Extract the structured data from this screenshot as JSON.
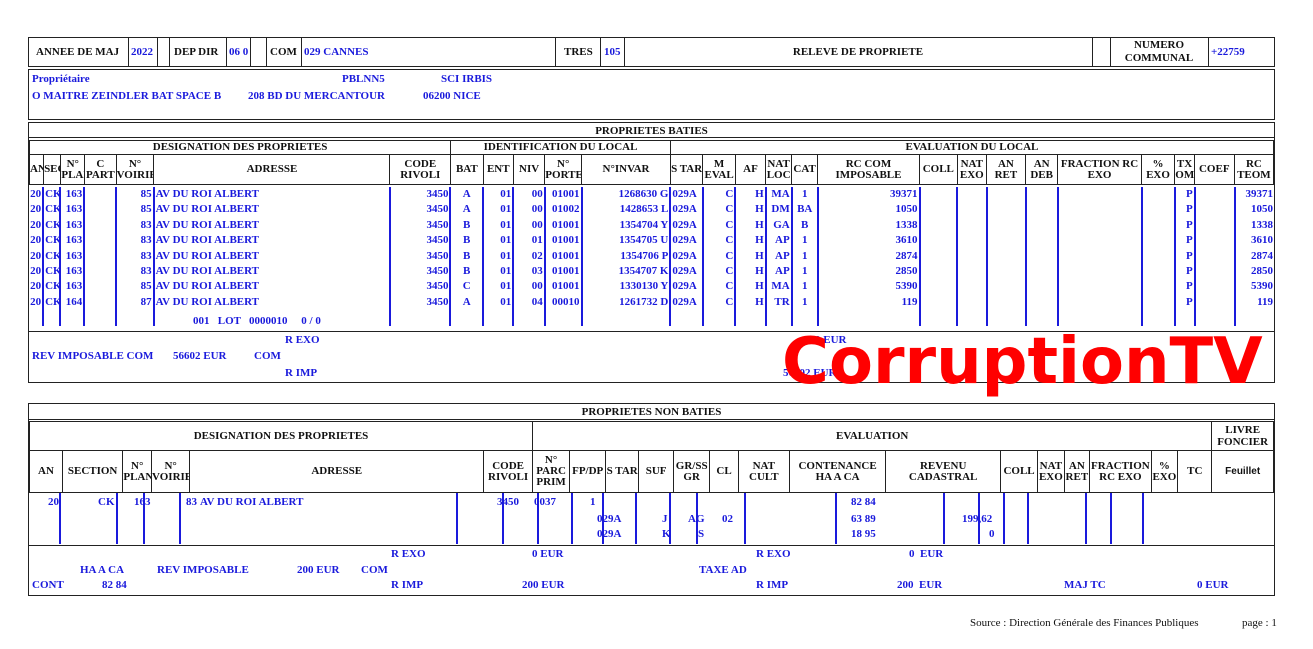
{
  "header": {
    "annee_label": "ANNEE DE MAJ",
    "annee": "2022",
    "depdir_label": "DEP DIR",
    "depdir": "06 0",
    "com_label": "COM",
    "com": "029 CANNES",
    "tres_label": "TRES",
    "tres": "105",
    "title": "RELEVE DE PROPRIETE",
    "numero_label_1": "NUMERO",
    "numero_label_2": "COMMUNAL",
    "numero": "+22759"
  },
  "owner": {
    "label": "Propriétaire",
    "code": "PBLNN5",
    "name": "SCI IRBIS",
    "addr1": "O MAITRE ZEINDLER BAT SPACE B",
    "addr2": "208 BD DU MERCANTOUR",
    "addr3": "06200 NICE"
  },
  "baties": {
    "title": "PROPRIETES BATIES",
    "group_designation": "DESIGNATION DES PROPRIETES",
    "group_ident": "IDENTIFICATION DU LOCAL",
    "group_eval": "EVALUATION DU LOCAL",
    "columns": [
      "AN",
      "SEC",
      "N° PLAN",
      "C PART",
      "N° VOIRIE",
      "ADRESSE",
      "CODE RIVOLI",
      "BAT",
      "ENT",
      "NIV",
      "N° PORTE",
      "N°INVAR",
      "S TAR",
      "M EVAL",
      "AF",
      "NAT LOC",
      "CAT",
      "RC COM IMPOSABLE",
      "COLL",
      "NAT EXO",
      "AN RET",
      "AN DEB",
      "FRACTION RC EXO",
      "% EXO",
      "TX OM",
      "COEF",
      "RC TEOM"
    ],
    "rows": [
      [
        "20",
        "CK",
        "163",
        "",
        "85",
        "AV DU ROI ALBERT",
        "3450",
        "A",
        "01",
        "00",
        "01001",
        "1268630 G",
        "029A",
        "C",
        "H",
        "MA",
        "1",
        "39371",
        "",
        "",
        "",
        "",
        "",
        "",
        "P",
        "",
        "39371"
      ],
      [
        "20",
        "CK",
        "163",
        "",
        "85",
        "AV DU ROI ALBERT",
        "3450",
        "A",
        "01",
        "00",
        "01002",
        "1428653 L",
        "029A",
        "C",
        "H",
        "DM",
        "BA",
        "1050",
        "",
        "",
        "",
        "",
        "",
        "",
        "P",
        "",
        "1050"
      ],
      [
        "20",
        "CK",
        "163",
        "",
        "83",
        "AV DU ROI ALBERT",
        "3450",
        "B",
        "01",
        "00",
        "01001",
        "1354704 Y",
        "029A",
        "C",
        "H",
        "GA",
        "B",
        "1338",
        "",
        "",
        "",
        "",
        "",
        "",
        "P",
        "",
        "1338"
      ],
      [
        "20",
        "CK",
        "163",
        "",
        "83",
        "AV DU ROI ALBERT",
        "3450",
        "B",
        "01",
        "01",
        "01001",
        "1354705 U",
        "029A",
        "C",
        "H",
        "AP",
        "1",
        "3610",
        "",
        "",
        "",
        "",
        "",
        "",
        "P",
        "",
        "3610"
      ],
      [
        "20",
        "CK",
        "163",
        "",
        "83",
        "AV DU ROI ALBERT",
        "3450",
        "B",
        "01",
        "02",
        "01001",
        "1354706 P",
        "029A",
        "C",
        "H",
        "AP",
        "1",
        "2874",
        "",
        "",
        "",
        "",
        "",
        "",
        "P",
        "",
        "2874"
      ],
      [
        "20",
        "CK",
        "163",
        "",
        "83",
        "AV DU ROI ALBERT",
        "3450",
        "B",
        "01",
        "03",
        "01001",
        "1354707 K",
        "029A",
        "C",
        "H",
        "AP",
        "1",
        "2850",
        "",
        "",
        "",
        "",
        "",
        "",
        "P",
        "",
        "2850"
      ],
      [
        "20",
        "CK",
        "163",
        "",
        "85",
        "AV DU ROI ALBERT",
        "3450",
        "C",
        "01",
        "00",
        "01001",
        "1330130 Y",
        "029A",
        "C",
        "H",
        "MA",
        "1",
        "5390",
        "",
        "",
        "",
        "",
        "",
        "",
        "P",
        "",
        "5390"
      ],
      [
        "20",
        "CK",
        "164",
        "",
        "87",
        "AV DU ROI ALBERT",
        "3450",
        "A",
        "01",
        "04",
        "00010",
        "1261732 D",
        "029A",
        "C",
        "H",
        "TR",
        "1",
        "119",
        "",
        "",
        "",
        "",
        "",
        "",
        "P",
        "",
        "119"
      ]
    ],
    "lot_line": "001   LOT   0000010     0 / 0",
    "summary": {
      "rexo": "R EXO",
      "rev_imposable": "REV IMPOSABLE COM",
      "rev_value": "56602 EUR",
      "com": "COM",
      "rimp": "R IMP",
      "rexo_right": "0 EUR",
      "rimp_right": "56602 EUR"
    }
  },
  "non_baties": {
    "title": "PROPRIETES NON BATIES",
    "group_designation": "DESIGNATION DES PROPRIETES",
    "group_eval": "EVALUATION",
    "livre_foncier": "LIVRE FONCIER",
    "columns": [
      "AN",
      "SECTION",
      "N° PLAN",
      "N° VOIRIE",
      "ADRESSE",
      "CODE RIVOLI",
      "N° PARC PRIM",
      "FP/DP",
      "S TAR",
      "SUF",
      "GR/SS GR",
      "CL",
      "NAT CULT",
      "CONTENANCE HA A CA",
      "REVENU CADASTRAL",
      "COLL",
      "NAT EXO",
      "AN RET",
      "FRACTION RC EXO",
      "% EXO",
      "TC",
      "Feuillet"
    ],
    "row": {
      "an": "20",
      "section": "CK",
      "plan": "163",
      "voirie": "83",
      "adresse": "AV DU ROI ALBERT",
      "rivoli": "3450",
      "parc": "0037",
      "fpdp": "1",
      "star": [
        "029A",
        "029A"
      ],
      "suf": [
        "J",
        "K"
      ],
      "grss": [
        "AG",
        "S"
      ],
      "cl": "02",
      "contenance": [
        "82 84",
        "63 89",
        "18 95"
      ],
      "revenu": [
        "199,62",
        "0"
      ]
    },
    "summary": {
      "rexo": "R EXO",
      "rexo_val": "0 EUR",
      "rexo2": "R EXO",
      "rexo2_val": "0  EUR",
      "haaca": "HA A CA",
      "rev_imposable": "REV IMPOSABLE",
      "rev_val": "200 EUR",
      "com": "COM",
      "taxe_ad": "TAXE AD",
      "cont": "CONT",
      "cont_val": "82 84",
      "rimp": "R IMP",
      "rimp_val": "200 EUR",
      "rimp2": "R IMP",
      "rimp2_val": "200  EUR",
      "maj_tc": "MAJ TC",
      "maj_tc_val": "0 EUR"
    }
  },
  "watermark": "CorruptionTV",
  "footer": {
    "source": "Source : Direction Générale des Finances Publiques",
    "page": "page : 1"
  }
}
